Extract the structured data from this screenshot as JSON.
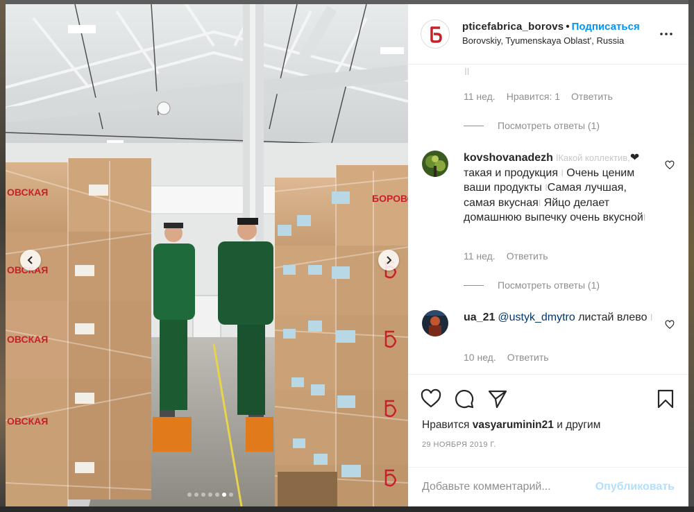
{
  "post": {
    "username": "pticefabrica_borovs",
    "follow_label": "Подписаться",
    "separator": "•",
    "location": "Borovskiy, Tyumenskaya Oblast', Russia"
  },
  "photo": {
    "box_brand": "БОРОВСКАЯ",
    "box_brand_partial": "ОВСКАЯ",
    "total_slides": 7,
    "active_slide": 6
  },
  "comments": {
    "first": {
      "partial_text": " ǀǀ",
      "time": "11 нед.",
      "likes": "Нравится: 1",
      "reply": "Ответить",
      "view_replies": "Посмотреть ответы (1)"
    },
    "second": {
      "user": "kovshovanadezh",
      "text_parts": [
        "ǀКакой коллектив,",
        "❤",
        " такая и продукция ",
        "ǀ",
        " Очень ценим ваши продукты ",
        "ǀ",
        "Самая лучшая, самая вкусная",
        "ǀ",
        " Яйцо делает домашнюю выпечку очень вкусной",
        "ǀ"
      ],
      "time": "11 нед.",
      "reply": "Ответить",
      "view_replies": "Посмотреть ответы (1)"
    },
    "third": {
      "user": "ua_21",
      "mention": "@ustyk_dmytro",
      "text": " листай влево ",
      "glyph": "ǀ",
      "time": "10 нед.",
      "reply": "Ответить"
    }
  },
  "actions": {
    "icons": [
      "heart-icon",
      "comment-icon",
      "share-icon",
      "bookmark-icon"
    ],
    "likes_prefix": "Нравится ",
    "likes_user": "vasyaruminin21",
    "likes_suffix": " и другим",
    "date": "29 ноября 2019 г."
  },
  "add_comment": {
    "placeholder": "Добавьте комментарий...",
    "publish_label": "Опубликовать"
  },
  "colors": {
    "accent": "#0095f6",
    "publish_disabled": "#b2dffc",
    "brand_red": "#c8202a",
    "muted": "#8e8e8e"
  }
}
